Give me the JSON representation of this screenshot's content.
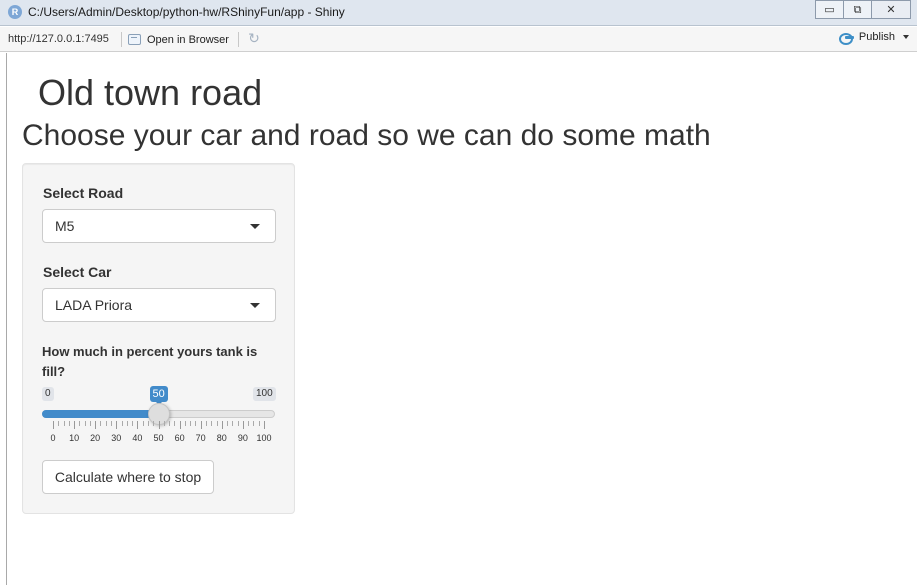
{
  "window": {
    "title": "C:/Users/Admin/Desktop/python-hw/RShinyFun/app - Shiny",
    "app_icon": "R"
  },
  "toolbar": {
    "url": "http://127.0.0.1:7495",
    "open_in_browser": "Open in Browser",
    "publish": "Publish"
  },
  "app": {
    "title": "Old town road",
    "subtitle": "Choose your car and road so we can do some math",
    "road": {
      "label": "Select Road",
      "value": "M5"
    },
    "car": {
      "label": "Select Car",
      "value": "LADA Priora"
    },
    "tank": {
      "label": "How much in percent yours tank is fill?",
      "min": 0,
      "max": 100,
      "value": 50,
      "min_label": "0",
      "max_label": "100",
      "value_label": "50",
      "tick_labels": [
        "0",
        "10",
        "20",
        "30",
        "40",
        "50",
        "60",
        "70",
        "80",
        "90",
        "100"
      ]
    },
    "calculate_button": "Calculate where to stop"
  },
  "colors": {
    "accent": "#428bca",
    "well_background": "#f5f5f5",
    "publish_icon": "#3e8fc7"
  }
}
